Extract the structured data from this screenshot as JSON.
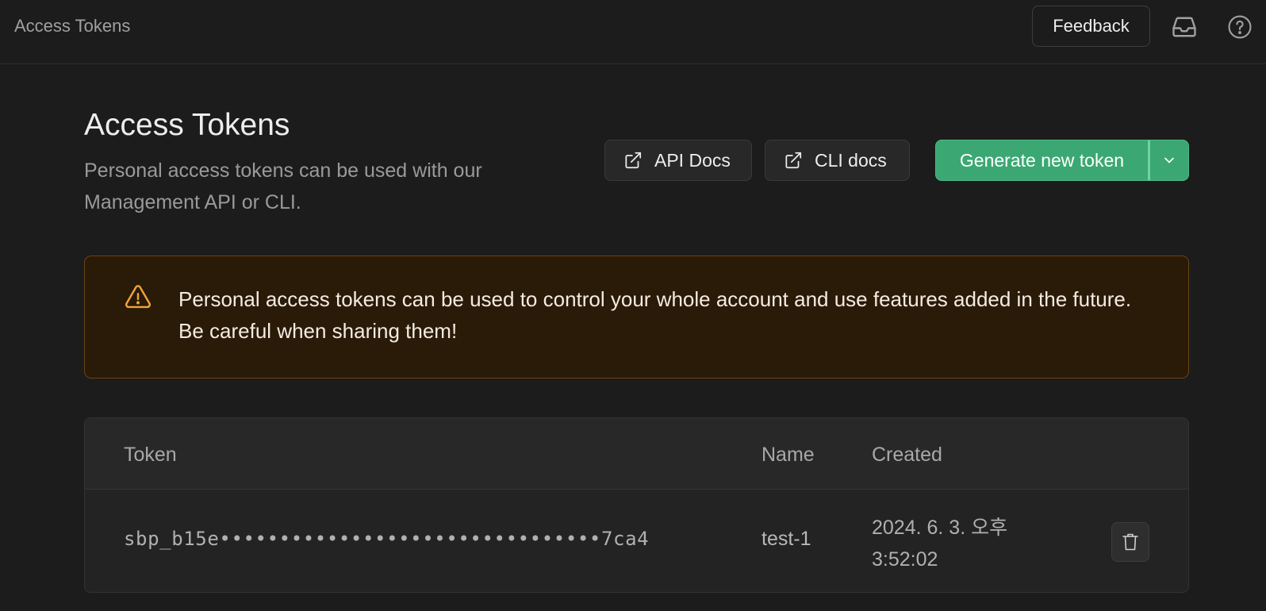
{
  "topbar": {
    "title": "Access Tokens",
    "feedback_label": "Feedback",
    "icons": [
      "inbox-icon",
      "help-icon"
    ]
  },
  "header": {
    "title": "Access Tokens",
    "description": "Personal access tokens can be used with our Management API or CLI.",
    "api_docs_label": "API Docs",
    "cli_docs_label": "CLI docs",
    "generate_label": "Generate new token"
  },
  "warning": {
    "text": "Personal access tokens can be used to control your whole account and use features added in the future. Be careful when sharing them!"
  },
  "table": {
    "columns": [
      "Token",
      "Name",
      "Created"
    ],
    "rows": [
      {
        "token": "sbp_b15e••••••••••••••••••••••••••••••••7ca4",
        "name": "test-1",
        "created": "2024. 6. 3. 오후 3:52:02"
      }
    ]
  },
  "colors": {
    "background": "#1c1c1c",
    "accent_green": "#3ba874",
    "warning_bg": "#2a1a08",
    "warning_border": "#6b4414",
    "warning_icon": "#f0a43a"
  }
}
